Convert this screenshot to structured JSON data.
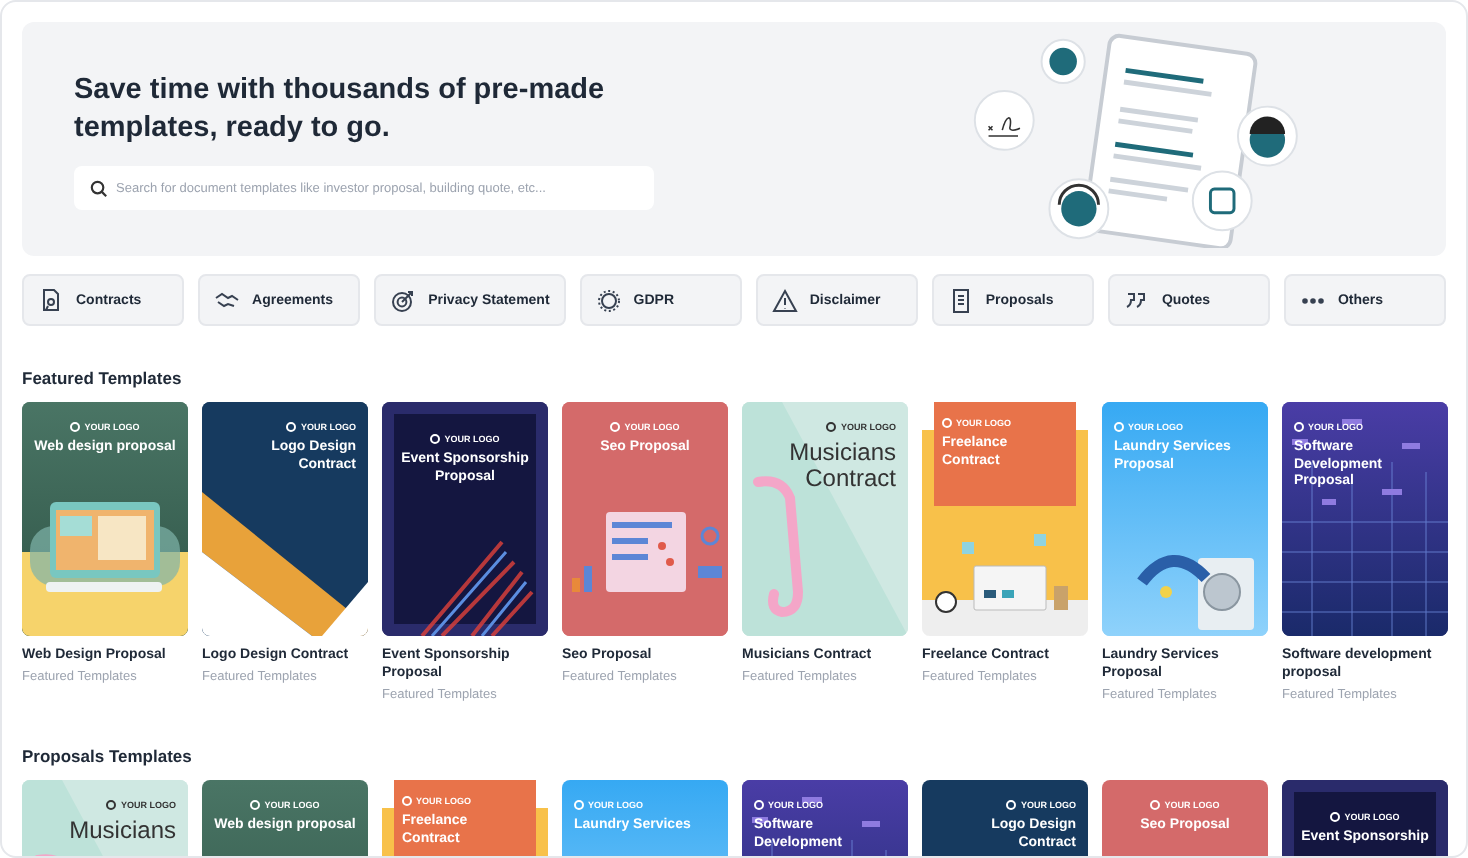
{
  "hero": {
    "heading": "Save time with thousands of pre-made templates, ready to go.",
    "search": {
      "placeholder": "Search for document templates like investor proposal, building quote, etc..."
    }
  },
  "categories": [
    "Contracts",
    "Agreements",
    "Privacy Statement",
    "GDPR",
    "Disclaimer",
    "Proposals",
    "Quotes",
    "Others"
  ],
  "sections": [
    {
      "heading": "Featured Templates",
      "templates": [
        {
          "title": "Web Design Proposal",
          "category": "Featured Templates",
          "thumbnail": {
            "kind": "web",
            "logo": "YOUR LOGO",
            "heading": "Web design proposal"
          }
        },
        {
          "title": "Logo Design Contract",
          "category": "Featured Templates",
          "thumbnail": {
            "kind": "logo",
            "logo": "YOUR LOGO",
            "heading": "Logo Design Contract"
          }
        },
        {
          "title": "Event Sponsorship Proposal",
          "category": "Featured Templates",
          "thumbnail": {
            "kind": "event",
            "logo": "YOUR LOGO",
            "heading": "Event Sponsorship Proposal"
          }
        },
        {
          "title": "Seo Proposal",
          "category": "Featured Templates",
          "thumbnail": {
            "kind": "seo",
            "logo": "YOUR LOGO",
            "heading": "Seo Proposal"
          }
        },
        {
          "title": "Musicians Contract",
          "category": "Featured Templates",
          "thumbnail": {
            "kind": "music",
            "logo": "YOUR LOGO",
            "heading": "Musicians Contract"
          }
        },
        {
          "title": "Freelance Contract",
          "category": "Featured Templates",
          "thumbnail": {
            "kind": "freelance",
            "logo": "YOUR LOGO",
            "heading": "Freelance Contract"
          }
        },
        {
          "title": "Laundry Services Proposal",
          "category": "Featured Templates",
          "thumbnail": {
            "kind": "laundry",
            "logo": "YOUR LOGO",
            "heading": "Laundry Services Proposal"
          }
        },
        {
          "title": "Software development proposal",
          "category": "Featured Templates",
          "thumbnail": {
            "kind": "software",
            "logo": "YOUR LOGO",
            "heading": "Software Development Proposal"
          }
        }
      ]
    },
    {
      "heading": "Proposals Templates",
      "templates": [
        {
          "thumbnail": {
            "kind": "music",
            "logo": "YOUR LOGO",
            "heading": "Musicians"
          }
        },
        {
          "thumbnail": {
            "kind": "web",
            "logo": "YOUR LOGO",
            "heading": "Web design proposal"
          }
        },
        {
          "thumbnail": {
            "kind": "freelance",
            "logo": "YOUR LOGO",
            "heading": "Freelance Contract"
          }
        },
        {
          "thumbnail": {
            "kind": "laundry",
            "logo": "YOUR LOGO",
            "heading": "Laundry Services"
          }
        },
        {
          "thumbnail": {
            "kind": "software",
            "logo": "YOUR LOGO",
            "heading": "Software Development"
          }
        },
        {
          "thumbnail": {
            "kind": "logo",
            "logo": "YOUR LOGO",
            "heading": "Logo Design Contract"
          }
        },
        {
          "thumbnail": {
            "kind": "seo",
            "logo": "YOUR LOGO",
            "heading": "Seo Proposal"
          }
        },
        {
          "thumbnail": {
            "kind": "event",
            "logo": "YOUR LOGO",
            "heading": "Event Sponsorship"
          }
        }
      ]
    }
  ]
}
